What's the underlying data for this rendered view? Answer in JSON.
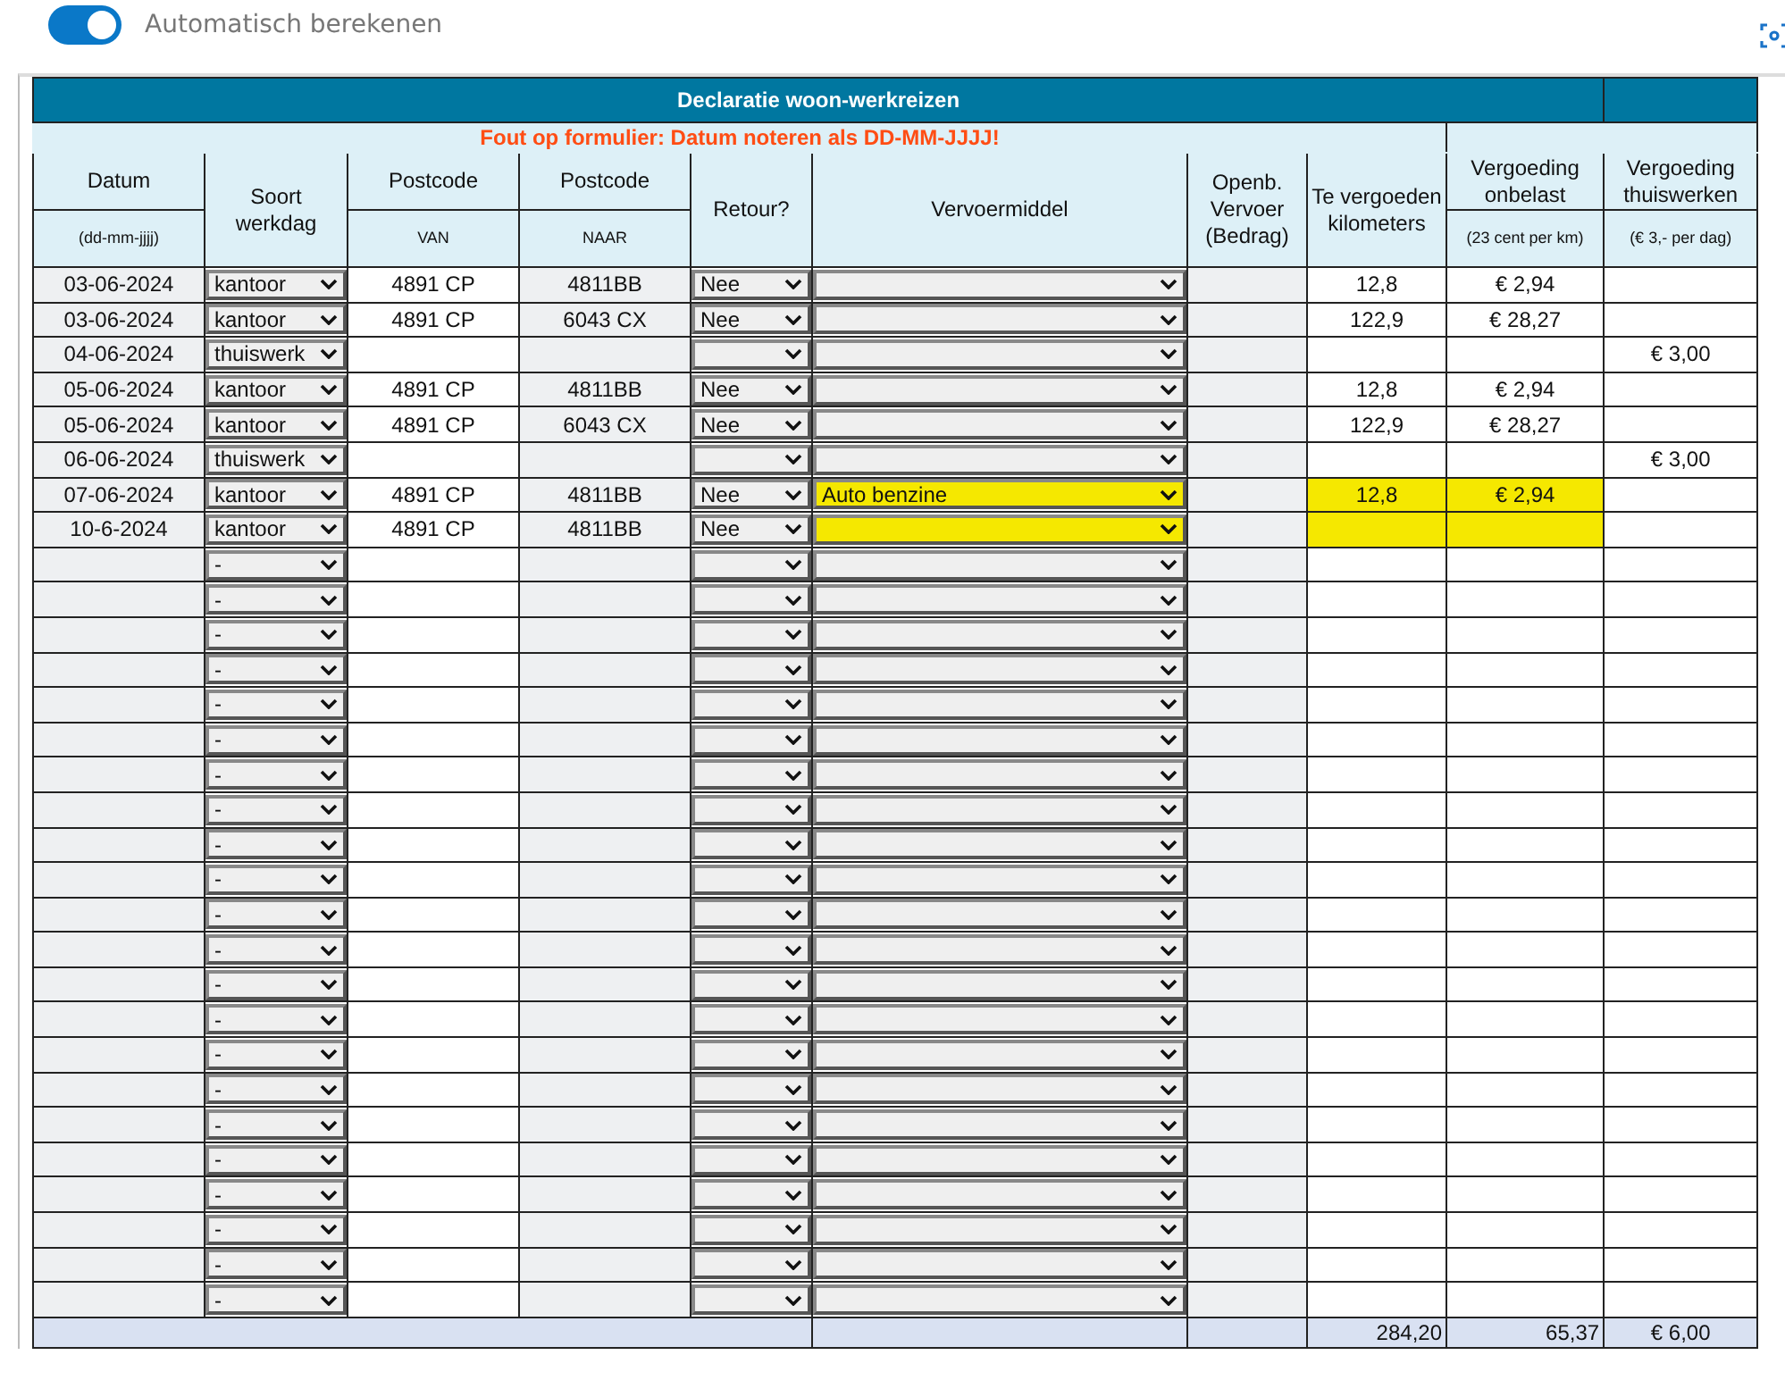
{
  "toggle": {
    "label": "Automatisch berekenen",
    "on": true
  },
  "table": {
    "title": "Declaratie woon-werkreizen",
    "error": "Fout op formulier: Datum noteren als DD-MM-JJJJ!",
    "columns": [
      {
        "label": "Datum",
        "sublabel": "(dd-mm-jjjj)"
      },
      {
        "label": "Soort werkdag"
      },
      {
        "label": "Postcode",
        "sublabel": "VAN"
      },
      {
        "label": "Postcode",
        "sublabel": "NAAR"
      },
      {
        "label": "Retour?"
      },
      {
        "label": "Vervoermiddel"
      },
      {
        "label": "Openb. Vervoer (Bedrag)"
      },
      {
        "label": "Te vergoeden kilometers"
      },
      {
        "label": "Vergoeding onbelast",
        "sublabel": "(23 cent per km)"
      },
      {
        "label": "Vergoeding thuiswerken",
        "sublabel": "(€ 3,- per dag)"
      }
    ],
    "rows": [
      {
        "datum": "03-06-2024",
        "soort": "kantoor",
        "van": "4891 CP",
        "naar": "4811BB",
        "retour": "Nee",
        "km": "12,8",
        "vergoeding": "€ 2,94",
        "highlighted": false
      },
      {
        "datum": "03-06-2024",
        "soort": "kantoor",
        "van": "4891 CP",
        "naar": "6043 CX",
        "retour": "Nee",
        "km": "122,9",
        "vergoeding": "€ 28,27",
        "highlighted": false
      },
      {
        "datum": "04-06-2024",
        "soort": "thuiswerk",
        "thuis": "€ 3,00",
        "highlighted": false
      },
      {
        "datum": "05-06-2024",
        "soort": "kantoor",
        "van": "4891 CP",
        "naar": "4811BB",
        "retour": "Nee",
        "km": "12,8",
        "vergoeding": "€ 2,94",
        "highlighted": false
      },
      {
        "datum": "05-06-2024",
        "soort": "kantoor",
        "van": "4891 CP",
        "naar": "6043 CX",
        "retour": "Nee",
        "km": "122,9",
        "vergoeding": "€ 28,27",
        "highlighted": false
      },
      {
        "datum": "06-06-2024",
        "soort": "thuiswerk",
        "thuis": "€ 3,00",
        "highlighted": false
      },
      {
        "datum": "07-06-2024",
        "soort": "kantoor",
        "van": "4891 CP",
        "naar": "4811BB",
        "retour": "Nee",
        "vervoer": "Auto benzine",
        "km": "12,8",
        "vergoeding": "€ 2,94",
        "highlighted": true
      },
      {
        "datum": "10-6-2024",
        "soort": "kantoor",
        "van": "4891 CP",
        "naar": "4811BB",
        "retour": "Nee",
        "highlighted": true
      },
      {
        "soort": "-",
        "highlighted": false
      },
      {
        "soort": "-",
        "highlighted": false
      },
      {
        "soort": "-",
        "highlighted": false
      },
      {
        "soort": "-",
        "highlighted": false
      },
      {
        "soort": "-",
        "highlighted": false
      },
      {
        "soort": "-",
        "highlighted": false
      },
      {
        "soort": "-",
        "highlighted": false
      },
      {
        "soort": "-",
        "highlighted": false
      },
      {
        "soort": "-",
        "highlighted": false
      },
      {
        "soort": "-",
        "highlighted": false
      },
      {
        "soort": "-",
        "highlighted": false
      },
      {
        "soort": "-",
        "highlighted": false
      },
      {
        "soort": "-",
        "highlighted": false
      },
      {
        "soort": "-",
        "highlighted": false
      },
      {
        "soort": "-",
        "highlighted": false
      },
      {
        "soort": "-",
        "highlighted": false
      },
      {
        "soort": "-",
        "highlighted": false
      },
      {
        "soort": "-",
        "highlighted": false
      },
      {
        "soort": "-",
        "highlighted": false
      },
      {
        "soort": "-",
        "highlighted": false
      },
      {
        "soort": "-",
        "highlighted": false
      },
      {
        "soort": "-",
        "highlighted": false
      }
    ],
    "totals": {
      "km": "284,20",
      "vergoeding": "65,37",
      "thuis": "€ 6,00"
    }
  }
}
